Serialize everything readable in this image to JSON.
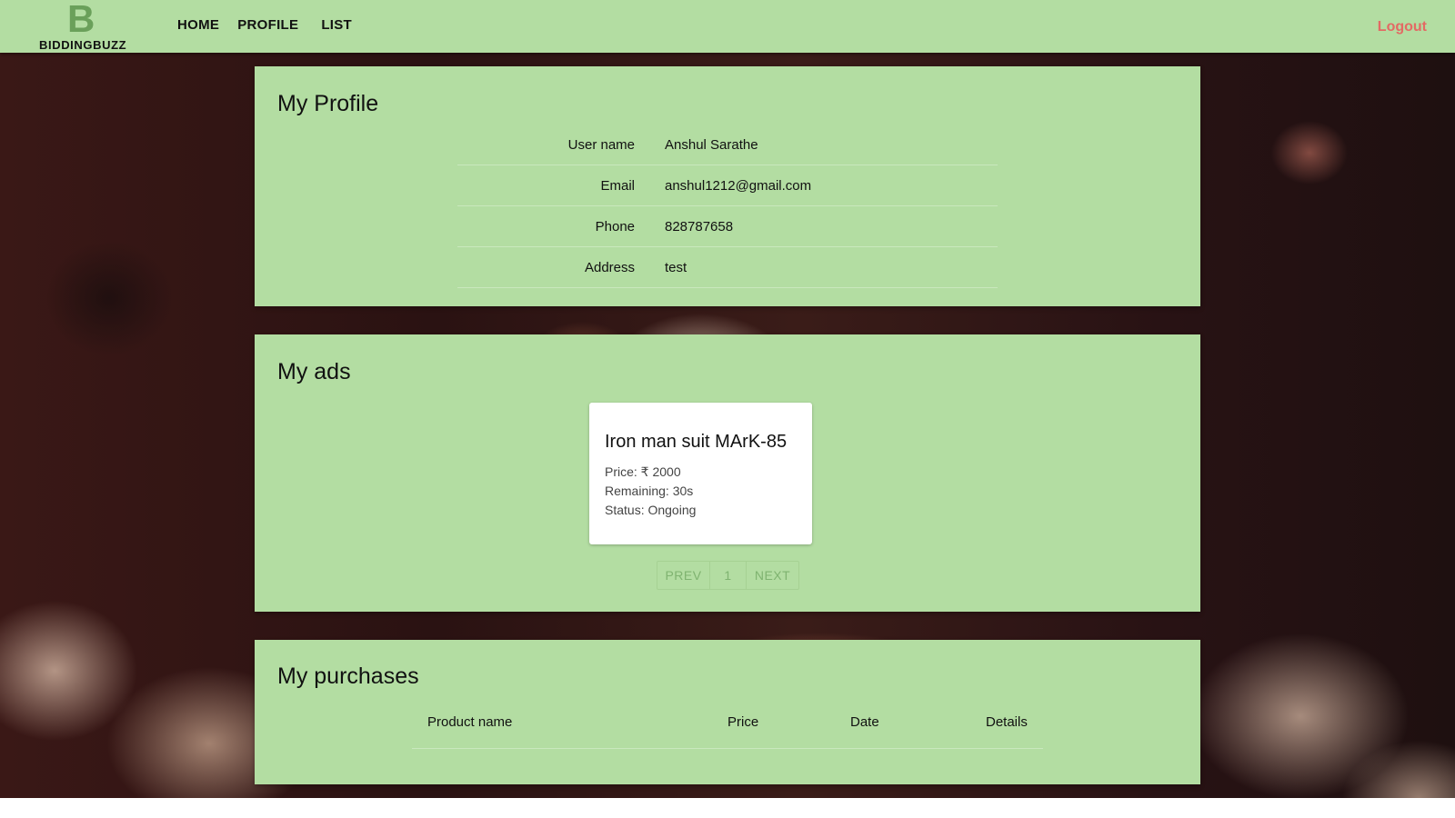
{
  "brand": {
    "mark": "B",
    "name": "BIDDINGBUZZ"
  },
  "nav": {
    "home": "HOME",
    "profile": "PROFILE",
    "list": "LIST",
    "logout": "Logout"
  },
  "profile": {
    "title": "My Profile",
    "rows": [
      {
        "label": "User name",
        "value": "Anshul Sarathe"
      },
      {
        "label": "Email",
        "value": "anshul1212@gmail.com"
      },
      {
        "label": "Phone",
        "value": "828787658"
      },
      {
        "label": "Address",
        "value": "test"
      }
    ]
  },
  "ads": {
    "title": "My ads",
    "items": [
      {
        "title": "Iron man suit MArK-85",
        "price": "Price: ₹ 2000",
        "remaining": "Remaining: 30s",
        "status": "Status: Ongoing"
      }
    ],
    "pager": {
      "prev": "PREV",
      "page": "1",
      "next": "NEXT"
    }
  },
  "purchases": {
    "title": "My purchases",
    "columns": [
      "Product name",
      "Price",
      "Date",
      "Details"
    ]
  },
  "colors": {
    "panel": "#b3dda2",
    "logout": "#e36a64",
    "accent": "#6aa05a"
  }
}
